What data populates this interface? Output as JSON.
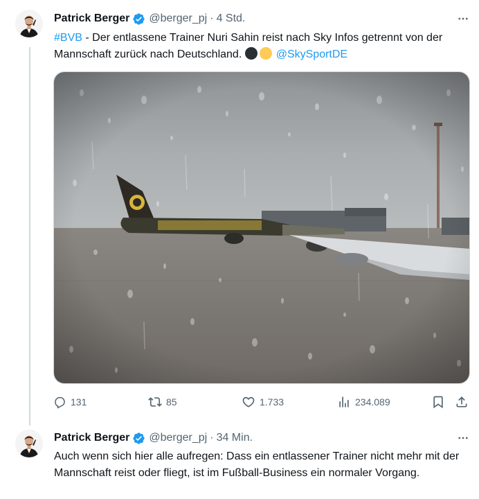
{
  "tweets": [
    {
      "author": "Patrick Berger",
      "handle": "@berger_pj",
      "separator": "·",
      "time": "4 Std.",
      "hashtag": "#BVB",
      "text_main": " - Der entlassene Trainer Nuri Sahin reist nach Sky Infos getrennt von der Mannschaft zurück nach Deutschland. ",
      "mention": "@SkySportDE",
      "emoji_icons": [
        "black-circle",
        "yellow-circle"
      ],
      "media": {
        "description_icon": "airplane-through-rainy-window-photo"
      },
      "actions": {
        "replies": "131",
        "reposts": "85",
        "likes": "1.733",
        "views": "234.089"
      }
    },
    {
      "author": "Patrick Berger",
      "handle": "@berger_pj",
      "separator": "·",
      "time": "34 Min.",
      "text": "Auch wenn sich hier alle aufregen: Dass ein entlassener Trainer nicht mehr mit der Mannschaft reist oder fliegt, ist im Fußball-Business ein normaler Vorgang."
    }
  ],
  "colors": {
    "accent": "#1d9bf0",
    "secondary_text": "#536471",
    "thread_line": "#cfd9de",
    "bvb_yellow": "#fdd835",
    "emoji_black": "#292f33"
  }
}
